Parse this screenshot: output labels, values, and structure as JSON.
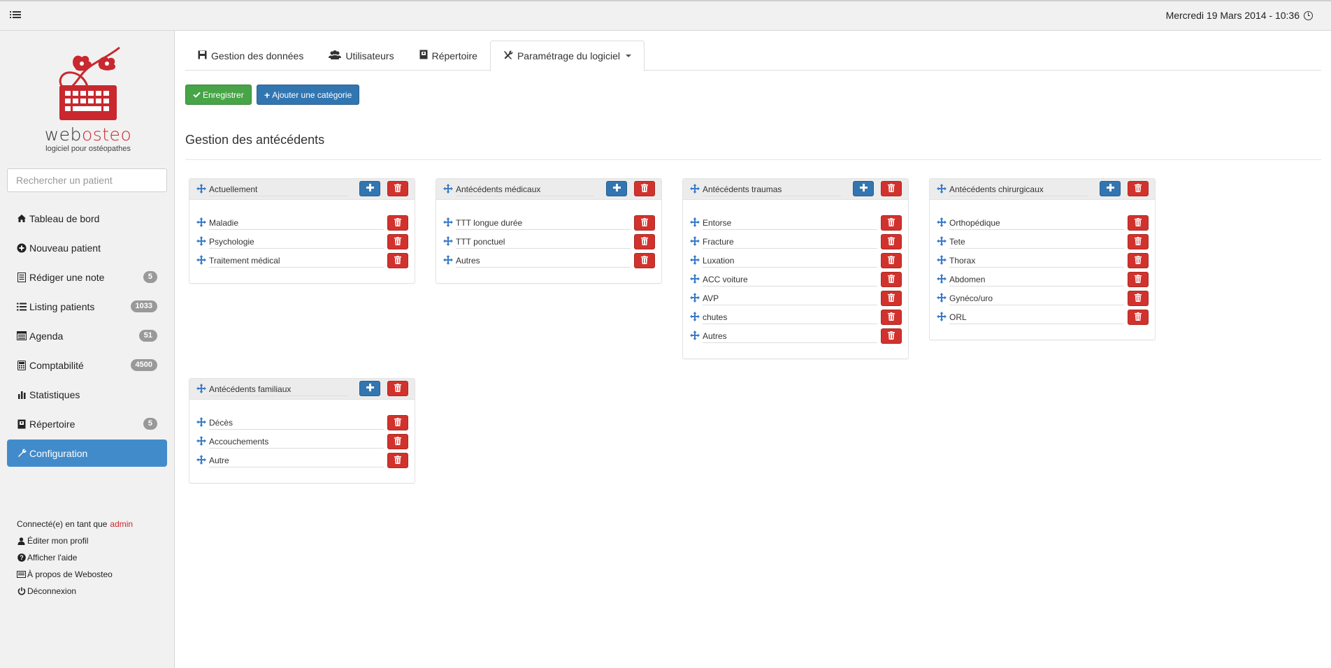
{
  "topbar": {
    "menu_icon": "list-icon",
    "date": "Mercredi 19 Mars 2014 - 10:36",
    "clock_icon": "clock-icon"
  },
  "sidebar": {
    "logo": {
      "name_part1": "web",
      "name_part2": "osteo",
      "tagline": "logiciel pour ostéopathes"
    },
    "search": {
      "placeholder": "Rechercher un patient"
    },
    "items": [
      {
        "label": "Tableau de bord",
        "icon": "home-icon",
        "badge": ""
      },
      {
        "label": "Nouveau patient",
        "icon": "plus-circle-icon",
        "badge": ""
      },
      {
        "label": "Rédiger une note",
        "icon": "note-icon",
        "badge": "5"
      },
      {
        "label": "Listing patients",
        "icon": "list-icon",
        "badge": "1033"
      },
      {
        "label": "Agenda",
        "icon": "calendar-icon",
        "badge": "51"
      },
      {
        "label": "Comptabilité",
        "icon": "calculator-icon",
        "badge": "4500"
      },
      {
        "label": "Statistiques",
        "icon": "bar-chart-icon",
        "badge": ""
      },
      {
        "label": "Répertoire",
        "icon": "book-icon",
        "badge": "5"
      },
      {
        "label": "Configuration",
        "icon": "wrench-icon",
        "badge": "",
        "active": true
      }
    ],
    "user": {
      "connected_label": "Connecté(e) en tant que",
      "username": "admin",
      "links": [
        {
          "label": "Éditer mon profil",
          "icon": "user-icon"
        },
        {
          "label": "Afficher l'aide",
          "icon": "question-icon"
        },
        {
          "label": "À propos de Webosteo",
          "icon": "info-card-icon"
        },
        {
          "label": "Déconnexion",
          "icon": "power-icon"
        }
      ]
    }
  },
  "main": {
    "tabs": [
      {
        "label": "Gestion des données",
        "icon": "floppy-icon"
      },
      {
        "label": "Utilisateurs",
        "icon": "users-icon"
      },
      {
        "label": "Répertoire",
        "icon": "book-icon"
      },
      {
        "label": "Paramétrage du logiciel",
        "icon": "tools-icon",
        "active": true,
        "dropdown": true
      }
    ],
    "save_button": "Enregistrer",
    "add_category_button": "Ajouter une catégorie",
    "section_title": "Gestion des antécédents",
    "categories": [
      {
        "name": "Actuellement",
        "items": [
          "Maladie",
          "Psychologie",
          "Traitement médical"
        ]
      },
      {
        "name": "Antécédents médicaux",
        "items": [
          "TTT longue durée",
          "TTT ponctuel",
          "Autres"
        ]
      },
      {
        "name": "Antécédents traumas",
        "items": [
          "Entorse",
          "Fracture",
          "Luxation",
          "ACC voiture",
          "AVP",
          "chutes",
          "Autres"
        ]
      },
      {
        "name": "Antécédents chirurgicaux",
        "items": [
          "Orthopédique",
          "Tete",
          "Thorax",
          "Abdomen",
          "Gynéco/uro",
          "ORL"
        ]
      },
      {
        "name": "Antécédents familiaux",
        "items": [
          "Décès",
          "Accouchements",
          "Autre"
        ]
      }
    ]
  },
  "colors": {
    "primary": "#428bca",
    "success": "#47a447",
    "danger": "#d2322d",
    "brand_red": "#c8282e",
    "badge": "#999999"
  }
}
